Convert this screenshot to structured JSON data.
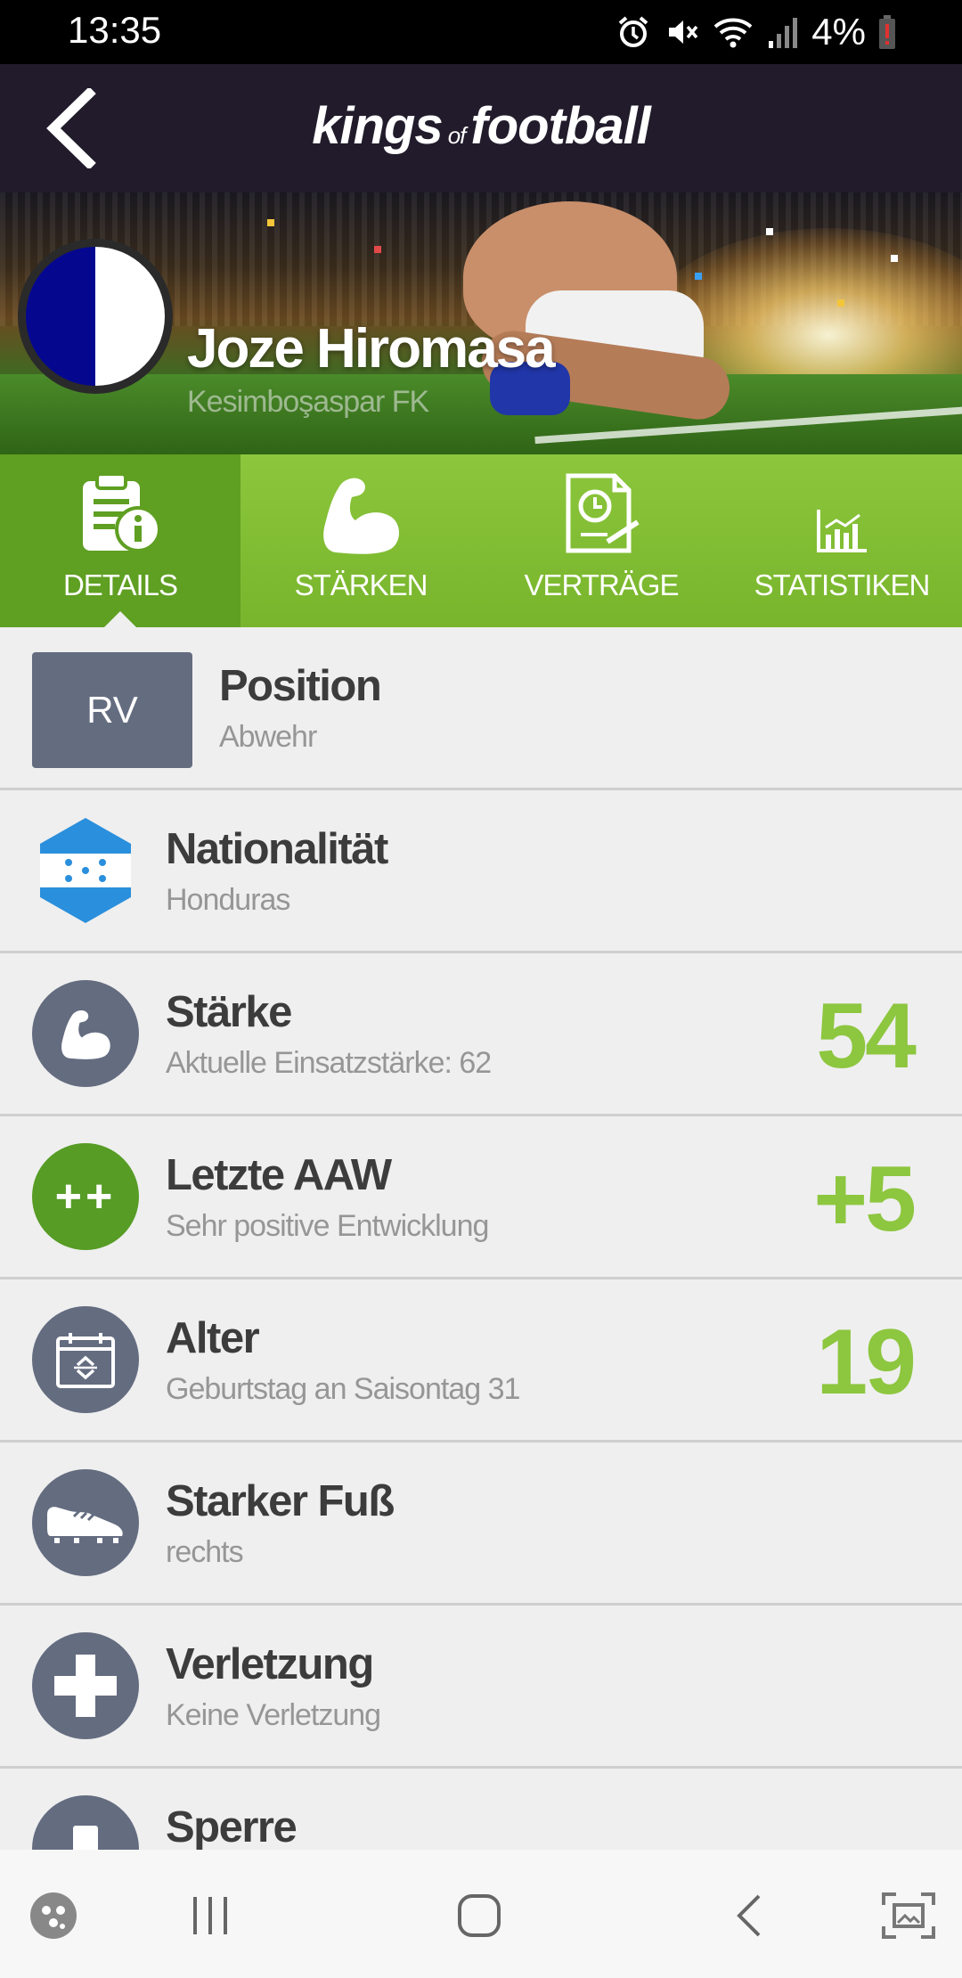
{
  "status_bar": {
    "time": "13:35",
    "battery_pct": "4%",
    "icons": [
      "alarm-icon",
      "mute-icon",
      "wifi-icon",
      "signal-icon",
      "battery-low-icon"
    ]
  },
  "header": {
    "logo_main": "kings",
    "logo_of": "of",
    "logo_end": "football",
    "back_icon": "chevron-left-icon"
  },
  "player": {
    "name": "Joze Hiromasa",
    "club": "Kesimboşaspar FK",
    "crest_colors": [
      "#05088f",
      "#ffffff"
    ]
  },
  "tabs": [
    {
      "label": "DETAILS",
      "icon": "clipboard-info-icon",
      "active": true
    },
    {
      "label": "STÄRKEN",
      "icon": "bicep-icon",
      "active": false
    },
    {
      "label": "VERTRÄGE",
      "icon": "contract-clock-icon",
      "active": false
    },
    {
      "label": "STATISTIKEN",
      "icon": "bar-chart-icon",
      "active": false
    }
  ],
  "details": {
    "position": {
      "badge": "RV",
      "title": "Position",
      "sub": "Abwehr"
    },
    "nationality": {
      "title": "Nationalität",
      "sub": "Honduras"
    },
    "strength": {
      "title": "Stärke",
      "sub": "Aktuelle Einsatzstärke: 62",
      "value": "54"
    },
    "last_aaw": {
      "icon_text": "++",
      "title": "Letzte AAW",
      "sub": "Sehr positive Entwicklung",
      "value": "+5"
    },
    "age": {
      "title": "Alter",
      "sub": "Geburtstag an Saisontag 31",
      "value": "19"
    },
    "foot": {
      "title": "Starker Fuß",
      "sub": "rechts"
    },
    "injury": {
      "title": "Verletzung",
      "sub": "Keine Verletzung"
    },
    "suspension": {
      "title": "Sperre"
    }
  },
  "colors": {
    "accent_green": "#8dc63f",
    "tab_active": "#5f9f22",
    "header_bg": "#211b2b",
    "icon_grey": "#646c80"
  },
  "navbar": {
    "icons": [
      "game-launcher-icon",
      "recent-apps-icon",
      "home-icon",
      "back-icon",
      "screenshot-icon"
    ]
  }
}
